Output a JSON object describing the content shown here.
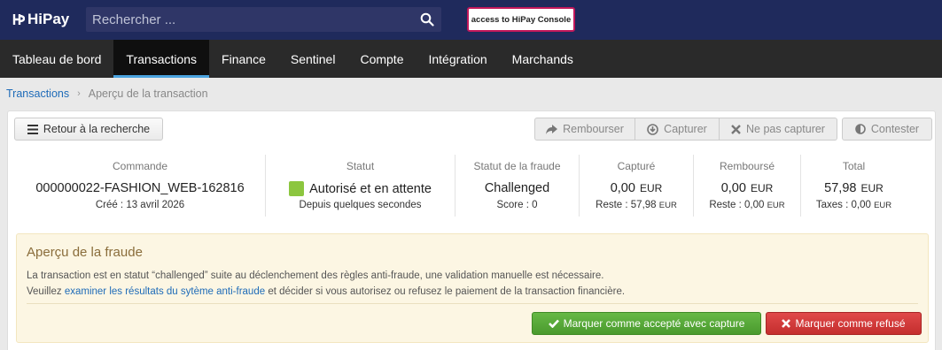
{
  "header": {
    "brand": "HiPay",
    "search_placeholder": "Rechercher ...",
    "console_button": "access to HiPay Console"
  },
  "nav": {
    "items": [
      {
        "label": "Tableau de bord",
        "active": false
      },
      {
        "label": "Transactions",
        "active": true
      },
      {
        "label": "Finance",
        "active": false
      },
      {
        "label": "Sentinel",
        "active": false
      },
      {
        "label": "Compte",
        "active": false
      },
      {
        "label": "Intégration",
        "active": false
      },
      {
        "label": "Marchands",
        "active": false
      }
    ]
  },
  "breadcrumb": {
    "root": "Transactions",
    "current": "Aperçu de la transaction"
  },
  "toolbar": {
    "back": "Retour à la recherche",
    "refund": "Rembourser",
    "capture": "Capturer",
    "no_capture": "Ne pas capturer",
    "dispute": "Contester"
  },
  "summary": {
    "order": {
      "label": "Commande",
      "value": "000000022-FASHION_WEB-162816",
      "sub": "Créé : 13 avril 2026"
    },
    "status": {
      "label": "Statut",
      "value": "Autorisé et en attente",
      "sub": "Depuis quelques secondes",
      "color": "#8cc63f"
    },
    "fraud": {
      "label": "Statut de la fraude",
      "value": "Challenged",
      "sub": "Score : 0"
    },
    "captured": {
      "label": "Capturé",
      "value": "0,00",
      "currency": "EUR",
      "sub": "Reste : 57,98",
      "sub_currency": "EUR"
    },
    "refunded": {
      "label": "Remboursé",
      "value": "0,00",
      "currency": "EUR",
      "sub": "Reste : 0,00",
      "sub_currency": "EUR"
    },
    "total": {
      "label": "Total",
      "value": "57,98",
      "currency": "EUR",
      "sub": "Taxes : 0,00",
      "sub_currency": "EUR"
    }
  },
  "fraud_alert": {
    "title": "Aperçu de la fraude",
    "line1": "La transaction est en statut “challenged” suite au déclenchement des règles anti-fraude, une validation manuelle est nécessaire.",
    "line2_before": "Veuillez ",
    "line2_link": "examiner les résultats du sytème anti-fraude",
    "line2_after": " et décider si vous autorisez ou refusez le paiement de la transaction financière.",
    "accept_button": "Marquer comme accepté avec capture",
    "refuse_button": "Marquer comme refusé"
  },
  "colors": {
    "header": "#1f2a5c",
    "nav": "#2a2a2a",
    "accent": "#4aa3df",
    "accept": "#5cb03a",
    "refuse": "#d43b3b"
  }
}
